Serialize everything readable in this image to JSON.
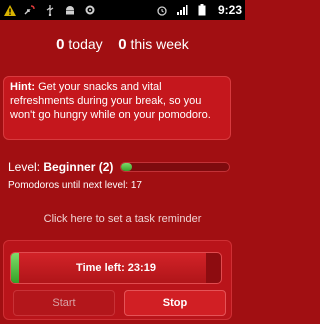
{
  "statusbar": {
    "icons": [
      "warning-icon",
      "phone-missed-icon",
      "usb-icon",
      "android-icon",
      "settings-icon",
      "alarm-icon",
      "signal-icon",
      "battery-icon"
    ],
    "time": "9:23"
  },
  "counts": {
    "today_value": "0",
    "today_label": "today",
    "week_value": "0",
    "week_label": "this week"
  },
  "hint": {
    "label": "Hint:",
    "text": "Get your snacks and vital refreshments during your break, so you won't go hungry while on your pomodoro."
  },
  "level": {
    "label": "Level:",
    "value": "Beginner (2)",
    "progress": 0.1,
    "until_next": "Pomodoros until next level: 17"
  },
  "reminder": {
    "text": "Click here to set a task reminder"
  },
  "timer": {
    "label": "Time left: 23:19",
    "remaining_fraction": 0.93
  },
  "buttons": {
    "start": "Start",
    "stop": "Stop"
  },
  "colors": {
    "background": "#a10f12",
    "accent_green": "#4cb83a"
  }
}
